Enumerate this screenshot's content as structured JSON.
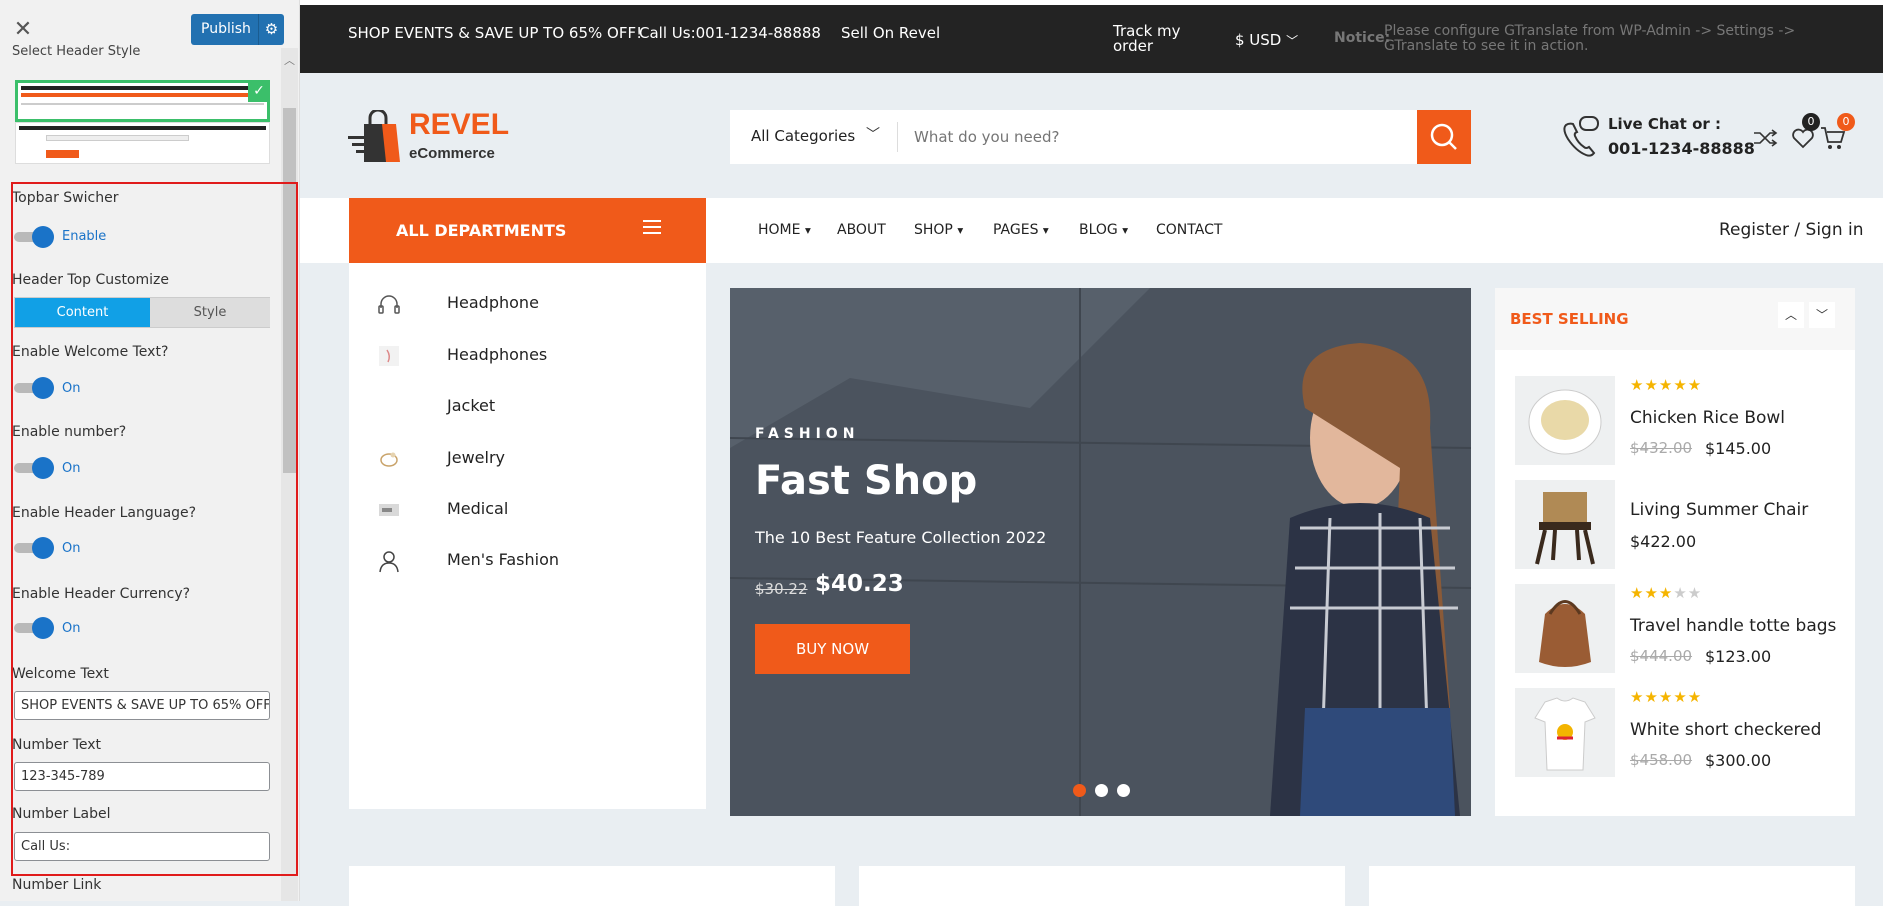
{
  "customizer": {
    "close_icon": "close-icon",
    "publish_label": "Publish",
    "gear_icon": "gear-icon",
    "section_heading": "Select Header Style",
    "topbar_switcher_label": "Topbar Swicher",
    "topbar_switcher_state": "Enable",
    "header_top_customize_label": "Header Top Customize",
    "tabs": [
      "Content",
      "Style"
    ],
    "enable_welcome_label": "Enable Welcome Text?",
    "enable_welcome_state": "On",
    "enable_number_label": "Enable number?",
    "enable_number_state": "On",
    "enable_language_label": "Enable Header Language?",
    "enable_language_state": "On",
    "enable_currency_label": "Enable Header Currency?",
    "enable_currency_state": "On",
    "welcome_text_label": "Welcome Text",
    "welcome_text_value": "SHOP EVENTS & SAVE UP TO 65% OFF",
    "number_text_label": "Number Text",
    "number_text_value": "123-345-789",
    "number_label_label": "Number Label",
    "number_label_value": "Call Us:",
    "number_link_label": "Number Link"
  },
  "topbar": {
    "welcome": "SHOP EVENTS & SAVE UP TO 65% OFF!",
    "call": "Call Us:001-1234-88888",
    "sell": "Sell On Revel",
    "track_line1": "Track my",
    "track_line2": "order",
    "currency": "$ USD",
    "notice_label": "Notice:",
    "notice_msg": "Please configure GTranslate from WP-Admin -> Settings -> GTranslate to see it in action."
  },
  "header": {
    "logo_word": "REVEL",
    "logo_sub": "eCommerce",
    "category_select": "All Categories",
    "search_placeholder": "What do you need?",
    "live_chat": "Live Chat or :",
    "phone": "001-1234-88888",
    "wishlist_count": "0",
    "cart_count": "0"
  },
  "nav": {
    "all_departments": "ALL DEPARTMENTS",
    "items": [
      "HOME",
      "ABOUT",
      "SHOP",
      "PAGES",
      "BLOG",
      "CONTACT"
    ],
    "register": "Register",
    "divider": "/",
    "signin": "Sign in"
  },
  "departments": [
    "Headphone",
    "Headphones",
    "Jacket",
    "Jewelry",
    "Medical",
    "Men's Fashion"
  ],
  "banner": {
    "kicker": "FASHION",
    "title": "Fast Shop",
    "subtitle": "The 10 Best Feature Collection 2022",
    "old_price": "$30.22",
    "new_price": "$40.23",
    "cta": "BUY NOW"
  },
  "best_selling": {
    "title": "BEST SELLING",
    "products": [
      {
        "name": "Chicken Rice Bowl",
        "old": "$432.00",
        "price": "$145.00",
        "rating": 5
      },
      {
        "name": "Living Summer Chair",
        "old": "",
        "price": "$422.00",
        "rating": 0
      },
      {
        "name": "Travel handle totte bags",
        "old": "$444.00",
        "price": "$123.00",
        "rating": 3
      },
      {
        "name": "White short checkered",
        "old": "$458.00",
        "price": "$300.00",
        "rating": 5
      }
    ]
  },
  "colors": {
    "accent": "#f05a1a",
    "topbar": "#232323",
    "customizer_blue": "#2271b1",
    "selected_green": "#3bbf6a",
    "highlight_red": "#e01b1b"
  }
}
